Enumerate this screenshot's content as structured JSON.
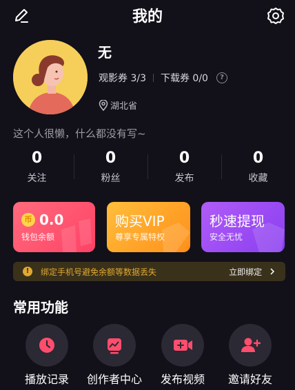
{
  "header": {
    "title": "我的"
  },
  "profile": {
    "name": "无",
    "ticket_view": "观影券 3/3",
    "ticket_download": "下载券 0/0",
    "help_glyph": "?",
    "location": "湖北省",
    "bio": "这个人很懒，什么都没有写~"
  },
  "stats": [
    {
      "value": "0",
      "label": "关注"
    },
    {
      "value": "0",
      "label": "粉丝"
    },
    {
      "value": "0",
      "label": "发布"
    },
    {
      "value": "0",
      "label": "收藏"
    }
  ],
  "cards": {
    "wallet": {
      "value": "0.0",
      "label": "钱包余额",
      "coin": "币"
    },
    "vip": {
      "title": "购买VIP",
      "subtitle": "尊享专属特权"
    },
    "withdraw": {
      "title": "秒速提现",
      "subtitle": "安全无忧"
    }
  },
  "notice": {
    "icon_glyph": "!",
    "text": "绑定手机号避免余额等数据丢失",
    "action": "立即绑定"
  },
  "functions": {
    "title": "常用功能",
    "items": [
      {
        "label": "播放记录",
        "icon": "clock-icon"
      },
      {
        "label": "创作者中心",
        "icon": "chart-icon"
      },
      {
        "label": "发布视频",
        "icon": "video-plus-icon"
      },
      {
        "label": "邀请好友",
        "icon": "user-plus-icon"
      }
    ]
  },
  "colors": {
    "background": "#12111a",
    "accent": "#ff4d6d",
    "wallet_card": "#ff5f73",
    "vip_card": "#ffa21c",
    "withdraw_card": "#9b4bf2",
    "notice_text": "#e0a830"
  }
}
